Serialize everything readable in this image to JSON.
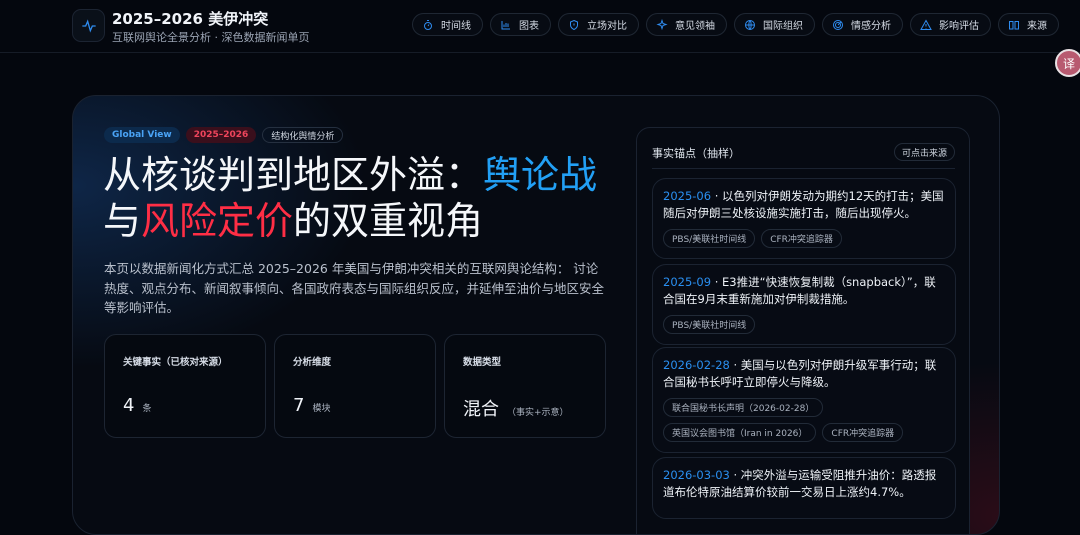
{
  "header": {
    "title": "2025–2026 美伊冲突",
    "subtitle": "互联网舆论全景分析 · 深色数据新闻单页"
  },
  "nav": [
    {
      "label": "时间线",
      "icon": "stopwatch-icon"
    },
    {
      "label": "图表",
      "icon": "bar-chart-icon"
    },
    {
      "label": "立场对比",
      "icon": "shield-icon"
    },
    {
      "label": "意见领袖",
      "icon": "sparkle-icon"
    },
    {
      "label": "国际组织",
      "icon": "globe-icon"
    },
    {
      "label": "情感分析",
      "icon": "radar-icon"
    },
    {
      "label": "影响评估",
      "icon": "warning-icon"
    },
    {
      "label": "来源",
      "icon": "book-icon"
    }
  ],
  "translate_label": "译",
  "hero": {
    "tags": [
      "Global View",
      "2025–2026",
      "结构化舆情分析"
    ],
    "title_part1": "从核谈判到地区外溢：",
    "title_highlight_blue": "舆论战",
    "title_part2": "与",
    "title_highlight_red": "风险定价",
    "title_part3": "的双重视角",
    "description": "本页以数据新闻化方式汇总 2025–2026 年美国与伊朗冲突相关的互联网舆论结构： 讨论热度、观点分布、新闻叙事倾向、各国政府表态与国际组织反应，并延伸至油价与地区安全等影响评估。",
    "stats": [
      {
        "label": "关键事实（已核对来源）",
        "value": "4",
        "unit": "条"
      },
      {
        "label": "分析维度",
        "value": "7",
        "unit": "模块"
      },
      {
        "label": "数据类型",
        "value": "混合",
        "unit": "（事实+示意）"
      }
    ]
  },
  "facts": {
    "title": "事实锚点（抽样）",
    "badge": "可点击来源",
    "items": [
      {
        "date": "2025-06",
        "text": " · 以色列对伊朗发动为期约12天的打击；美国随后对伊朗三处核设施实施打击，随后出现停火。",
        "sources": [
          "PBS/美联社时间线",
          "CFR冲突追踪器"
        ]
      },
      {
        "date": "2025-09",
        "text": " · E3推进“快速恢复制裁（snapback）”，联合国在9月末重新施加对伊制裁措施。",
        "sources": [
          "PBS/美联社时间线"
        ]
      },
      {
        "date": "2026-02-28",
        "text": " · 美国与以色列对伊朗升级军事行动；联合国秘书长呼吁立即停火与降级。",
        "sources": [
          "联合国秘书长声明（2026-02-28）",
          "英国议会图书馆（Iran in 2026）",
          "CFR冲突追踪器"
        ]
      },
      {
        "date": "2026-03-03",
        "text": " · 冲突外溢与运输受阻推升油价：路透报道布伦特原油结算价较前一交易日上涨约4.7%。",
        "sources": []
      }
    ]
  },
  "colors": {
    "accent_blue": "#22a0f5",
    "accent_red": "#ff2e45",
    "bg": "#04070e"
  }
}
